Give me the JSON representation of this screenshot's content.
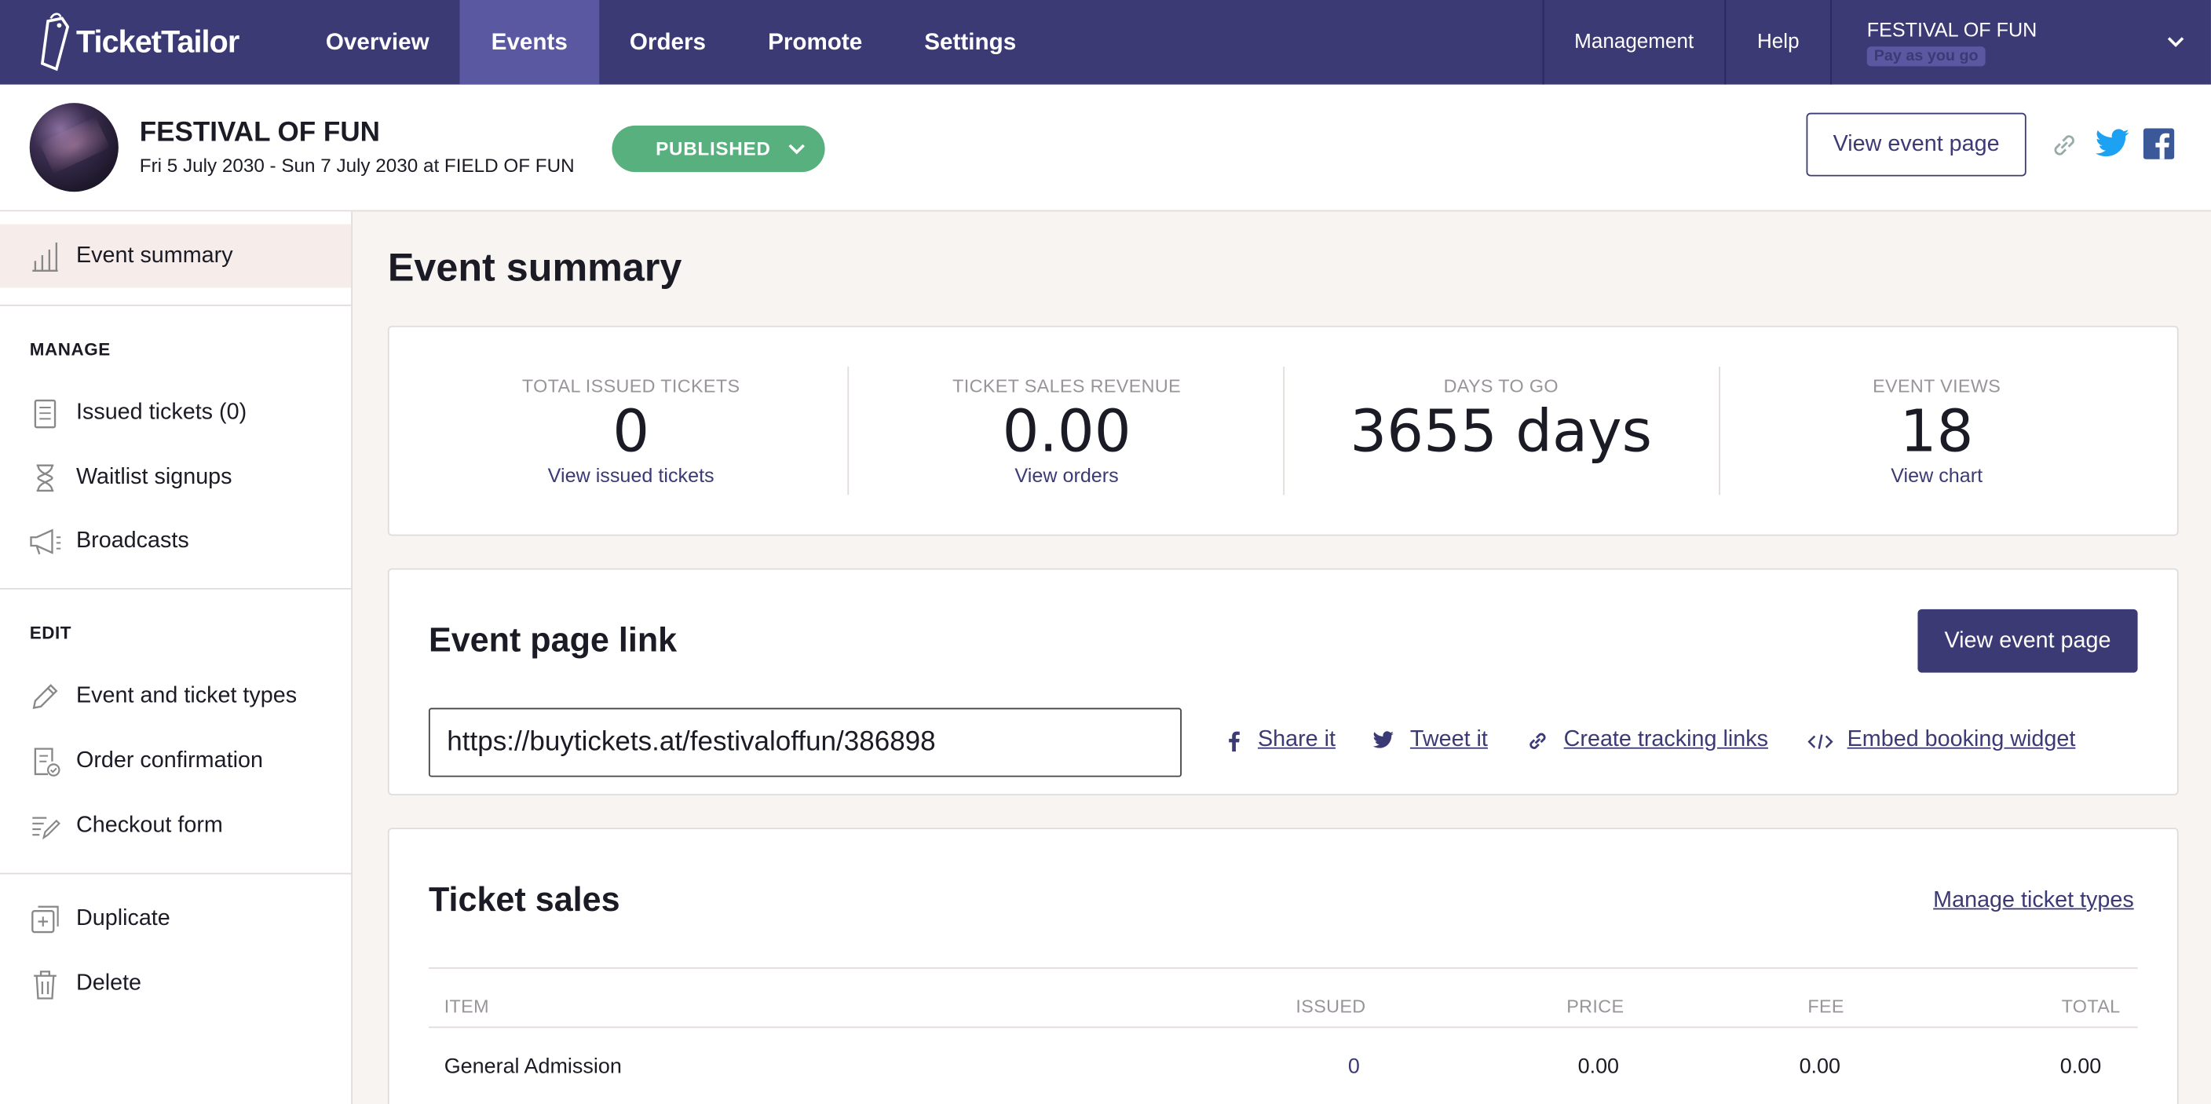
{
  "nav": {
    "logo": "TicketTailor",
    "items": [
      "Overview",
      "Events",
      "Orders",
      "Promote",
      "Settings"
    ],
    "active": "Events",
    "right": [
      "Management",
      "Help"
    ],
    "account_name": "FESTIVAL OF FUN",
    "account_plan": "Pay as you go"
  },
  "event": {
    "title": "FESTIVAL OF FUN",
    "date": "Fri 5 July 2030 - Sun 7 July 2030 at FIELD OF FUN",
    "status": "PUBLISHED",
    "view_page": "View event page"
  },
  "sidebar": {
    "summary": "Event summary",
    "manage_header": "MANAGE",
    "manage": [
      "Issued tickets (0)",
      "Waitlist signups",
      "Broadcasts"
    ],
    "edit_header": "EDIT",
    "edit": [
      "Event and ticket types",
      "Order confirmation",
      "Checkout form"
    ],
    "other": [
      "Duplicate",
      "Delete"
    ]
  },
  "main": {
    "title": "Event summary",
    "stats": [
      {
        "label": "TOTAL ISSUED TICKETS",
        "value": "0",
        "link": "View issued tickets"
      },
      {
        "label": "TICKET SALES REVENUE",
        "value": "0.00",
        "link": "View orders"
      },
      {
        "label": "DAYS TO GO",
        "value": "3655 days",
        "link": ""
      },
      {
        "label": "EVENT VIEWS",
        "value": "18",
        "link": "View chart"
      }
    ],
    "link_section": {
      "title": "Event page link",
      "button": "View event page",
      "url": "https://buytickets.at/festivaloffun/386898",
      "actions": [
        "Share it",
        "Tweet it",
        "Create tracking links",
        "Embed booking widget"
      ]
    },
    "sales": {
      "title": "Ticket sales",
      "manage_link": "Manage ticket types",
      "columns": [
        "ITEM",
        "ISSUED",
        "PRICE",
        "FEE",
        "TOTAL"
      ],
      "rows": [
        {
          "item": "General Admission",
          "issued": "0",
          "price": "0.00",
          "fee": "0.00",
          "total": "0.00"
        }
      ]
    }
  },
  "colors": {
    "nav_bg": "#3c3a75",
    "nav_active": "#5a58a0",
    "published": "#57b07d",
    "twitter": "#1da1f2",
    "facebook": "#3b5998"
  }
}
